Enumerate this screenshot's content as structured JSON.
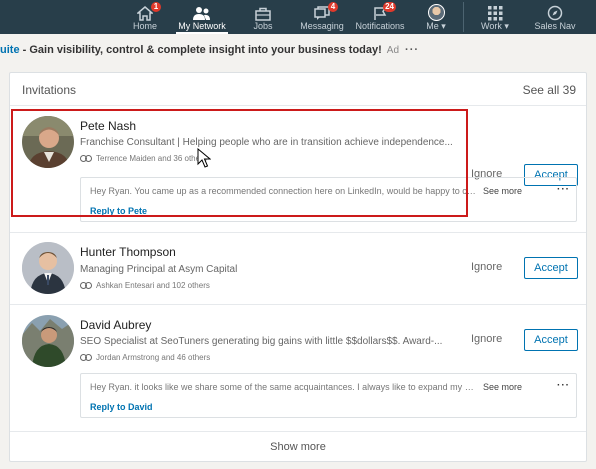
{
  "nav": {
    "items": [
      {
        "label": "Home",
        "badge": "1"
      },
      {
        "label": "My Network",
        "badge": ""
      },
      {
        "label": "Jobs",
        "badge": ""
      },
      {
        "label": "Messaging",
        "badge": "4"
      },
      {
        "label": "Notifications",
        "badge": "24"
      },
      {
        "label": "Me",
        "badge": ""
      },
      {
        "label": "Work",
        "badge": ""
      },
      {
        "label": "Sales Nav",
        "badge": ""
      }
    ]
  },
  "ad": {
    "link": "uite",
    "text": " - Gain visibility, control & complete insight into your business today!",
    "tag": "Ad",
    "more": "···"
  },
  "invitations": {
    "title": "Invitations",
    "see_all": "See all 39",
    "ignore_label": "Ignore",
    "accept_label": "Accept",
    "see_more_label": "See more",
    "items": [
      {
        "name": "Pete Nash",
        "headline": "Franchise Consultant | Helping people who are in transition achieve independence...",
        "mutual": "Terrence Maiden and 36 others",
        "message": "Hey Ryan. You came up as a recommended connection here on LinkedIn, would be happy to connect",
        "reply": "Reply to Pete"
      },
      {
        "name": "Hunter Thompson",
        "headline": "Managing Principal at Asym Capital",
        "mutual": "Ashkan Entesari and 102 others"
      },
      {
        "name": "David Aubrey",
        "headline": "SEO Specialist at SeoTuners generating big gains with little $$dollars$$. Award-...",
        "mutual": "Jordan Armstrong and 46 others",
        "message": "Hey Ryan. it looks like we share some of the same acquaintances. I always like to expand my network",
        "reply": "Reply to David"
      }
    ],
    "show_more": "Show more"
  },
  "colors": {
    "nav_bg": "#283e4a",
    "accent": "#0073b1",
    "highlight": "#cc1a1a",
    "badge": "#e0392b"
  }
}
